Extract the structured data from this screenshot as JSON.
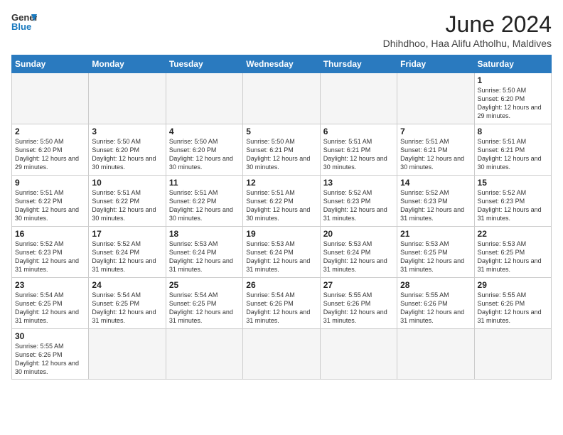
{
  "header": {
    "logo_line1": "General",
    "logo_line2": "Blue",
    "title": "June 2024",
    "subtitle": "Dhihdhoo, Haa Alifu Atholhu, Maldives"
  },
  "weekdays": [
    "Sunday",
    "Monday",
    "Tuesday",
    "Wednesday",
    "Thursday",
    "Friday",
    "Saturday"
  ],
  "weeks": [
    [
      {
        "day": "",
        "info": ""
      },
      {
        "day": "",
        "info": ""
      },
      {
        "day": "",
        "info": ""
      },
      {
        "day": "",
        "info": ""
      },
      {
        "day": "",
        "info": ""
      },
      {
        "day": "",
        "info": ""
      },
      {
        "day": "1",
        "info": "Sunrise: 5:50 AM\nSunset: 6:20 PM\nDaylight: 12 hours\nand 29 minutes."
      }
    ],
    [
      {
        "day": "2",
        "info": "Sunrise: 5:50 AM\nSunset: 6:20 PM\nDaylight: 12 hours\nand 29 minutes."
      },
      {
        "day": "3",
        "info": "Sunrise: 5:50 AM\nSunset: 6:20 PM\nDaylight: 12 hours\nand 30 minutes."
      },
      {
        "day": "4",
        "info": "Sunrise: 5:50 AM\nSunset: 6:20 PM\nDaylight: 12 hours\nand 30 minutes."
      },
      {
        "day": "5",
        "info": "Sunrise: 5:50 AM\nSunset: 6:21 PM\nDaylight: 12 hours\nand 30 minutes."
      },
      {
        "day": "6",
        "info": "Sunrise: 5:51 AM\nSunset: 6:21 PM\nDaylight: 12 hours\nand 30 minutes."
      },
      {
        "day": "7",
        "info": "Sunrise: 5:51 AM\nSunset: 6:21 PM\nDaylight: 12 hours\nand 30 minutes."
      },
      {
        "day": "8",
        "info": "Sunrise: 5:51 AM\nSunset: 6:21 PM\nDaylight: 12 hours\nand 30 minutes."
      }
    ],
    [
      {
        "day": "9",
        "info": "Sunrise: 5:51 AM\nSunset: 6:22 PM\nDaylight: 12 hours\nand 30 minutes."
      },
      {
        "day": "10",
        "info": "Sunrise: 5:51 AM\nSunset: 6:22 PM\nDaylight: 12 hours\nand 30 minutes."
      },
      {
        "day": "11",
        "info": "Sunrise: 5:51 AM\nSunset: 6:22 PM\nDaylight: 12 hours\nand 30 minutes."
      },
      {
        "day": "12",
        "info": "Sunrise: 5:51 AM\nSunset: 6:22 PM\nDaylight: 12 hours\nand 30 minutes."
      },
      {
        "day": "13",
        "info": "Sunrise: 5:52 AM\nSunset: 6:23 PM\nDaylight: 12 hours\nand 31 minutes."
      },
      {
        "day": "14",
        "info": "Sunrise: 5:52 AM\nSunset: 6:23 PM\nDaylight: 12 hours\nand 31 minutes."
      },
      {
        "day": "15",
        "info": "Sunrise: 5:52 AM\nSunset: 6:23 PM\nDaylight: 12 hours\nand 31 minutes."
      }
    ],
    [
      {
        "day": "16",
        "info": "Sunrise: 5:52 AM\nSunset: 6:23 PM\nDaylight: 12 hours\nand 31 minutes."
      },
      {
        "day": "17",
        "info": "Sunrise: 5:52 AM\nSunset: 6:24 PM\nDaylight: 12 hours\nand 31 minutes."
      },
      {
        "day": "18",
        "info": "Sunrise: 5:53 AM\nSunset: 6:24 PM\nDaylight: 12 hours\nand 31 minutes."
      },
      {
        "day": "19",
        "info": "Sunrise: 5:53 AM\nSunset: 6:24 PM\nDaylight: 12 hours\nand 31 minutes."
      },
      {
        "day": "20",
        "info": "Sunrise: 5:53 AM\nSunset: 6:24 PM\nDaylight: 12 hours\nand 31 minutes."
      },
      {
        "day": "21",
        "info": "Sunrise: 5:53 AM\nSunset: 6:25 PM\nDaylight: 12 hours\nand 31 minutes."
      },
      {
        "day": "22",
        "info": "Sunrise: 5:53 AM\nSunset: 6:25 PM\nDaylight: 12 hours\nand 31 minutes."
      }
    ],
    [
      {
        "day": "23",
        "info": "Sunrise: 5:54 AM\nSunset: 6:25 PM\nDaylight: 12 hours\nand 31 minutes."
      },
      {
        "day": "24",
        "info": "Sunrise: 5:54 AM\nSunset: 6:25 PM\nDaylight: 12 hours\nand 31 minutes."
      },
      {
        "day": "25",
        "info": "Sunrise: 5:54 AM\nSunset: 6:25 PM\nDaylight: 12 hours\nand 31 minutes."
      },
      {
        "day": "26",
        "info": "Sunrise: 5:54 AM\nSunset: 6:26 PM\nDaylight: 12 hours\nand 31 minutes."
      },
      {
        "day": "27",
        "info": "Sunrise: 5:55 AM\nSunset: 6:26 PM\nDaylight: 12 hours\nand 31 minutes."
      },
      {
        "day": "28",
        "info": "Sunrise: 5:55 AM\nSunset: 6:26 PM\nDaylight: 12 hours\nand 31 minutes."
      },
      {
        "day": "29",
        "info": "Sunrise: 5:55 AM\nSunset: 6:26 PM\nDaylight: 12 hours\nand 31 minutes."
      }
    ],
    [
      {
        "day": "30",
        "info": "Sunrise: 5:55 AM\nSunset: 6:26 PM\nDaylight: 12 hours\nand 30 minutes."
      },
      {
        "day": "",
        "info": ""
      },
      {
        "day": "",
        "info": ""
      },
      {
        "day": "",
        "info": ""
      },
      {
        "day": "",
        "info": ""
      },
      {
        "day": "",
        "info": ""
      },
      {
        "day": "",
        "info": ""
      }
    ]
  ]
}
